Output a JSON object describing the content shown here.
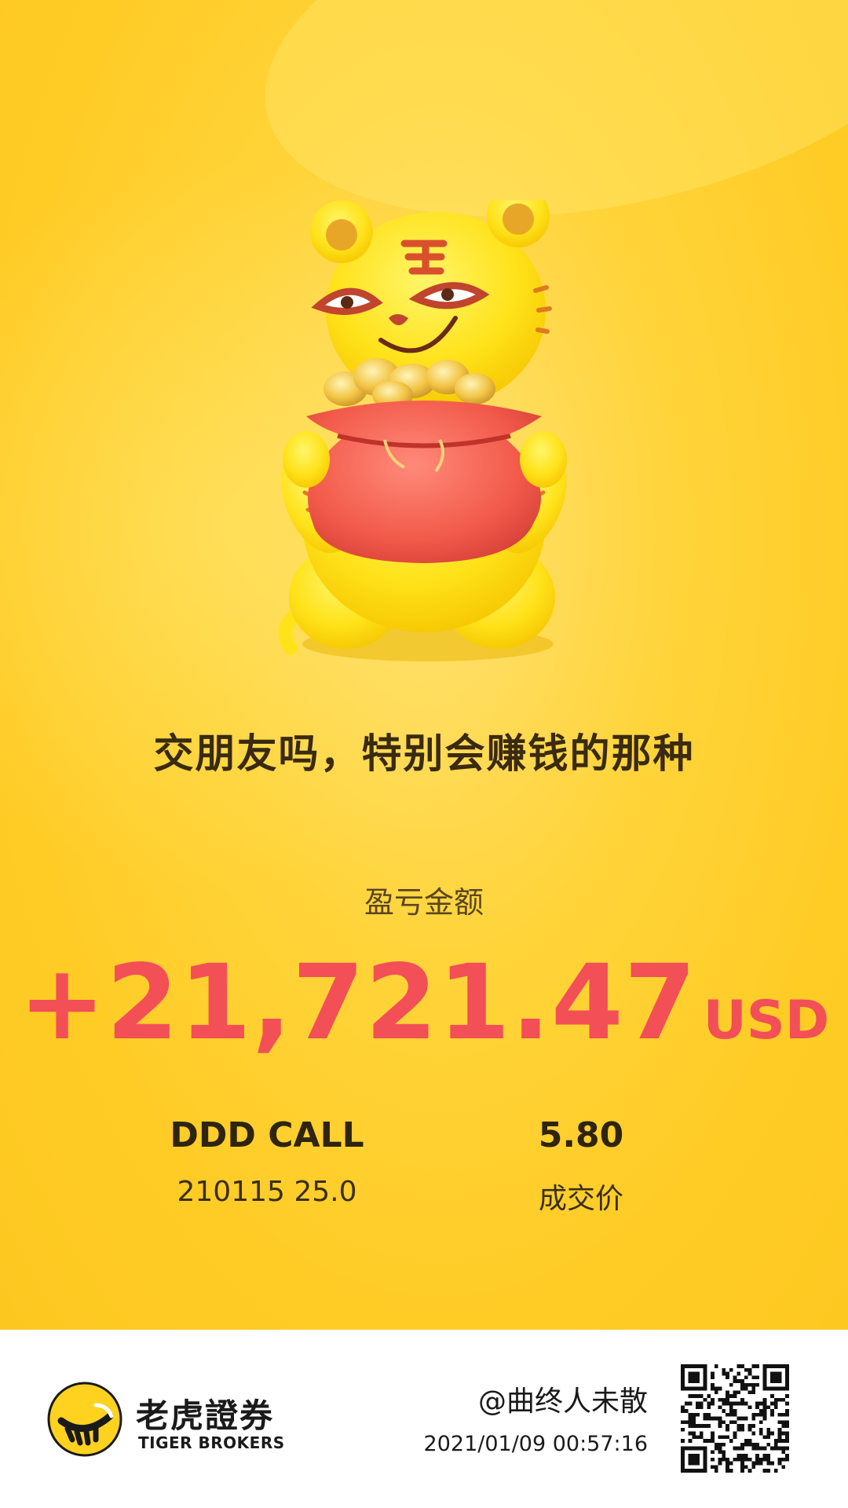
{
  "slogan": "交朋友吗，特别会赚钱的那种",
  "profit_loss": {
    "label": "盈亏金额",
    "amount": "+21,721.47",
    "currency": "USD"
  },
  "instrument": {
    "name": "DDD CALL",
    "contract": "210115 25.0"
  },
  "price": {
    "value": "5.80",
    "label": "成交价"
  },
  "footer": {
    "brand_cn": "老虎證券",
    "brand_en": "TIGER BROKERS",
    "user": "@曲终人未散",
    "timestamp": "2021/01/09 00:57:16"
  },
  "icons": {
    "mascot": "tiger-mascot-with-money-bag-icon",
    "logo": "tiger-brokers-logo-icon",
    "qr": "qr-code-icon"
  },
  "colors": {
    "background": "#ffcc26",
    "profit": "#f24f57",
    "text_dark": "#2e2410",
    "footer_bg": "#ffffff"
  }
}
